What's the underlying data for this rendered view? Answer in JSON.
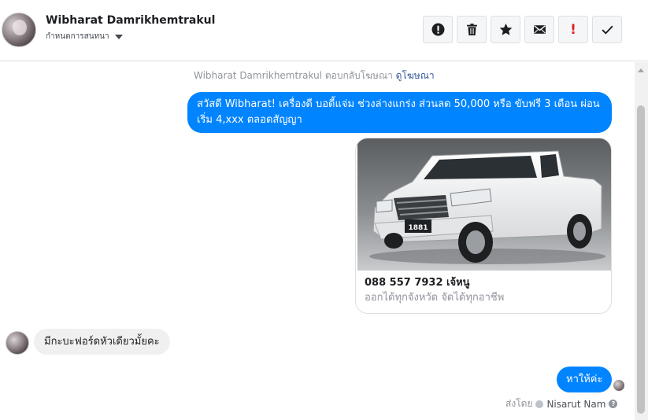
{
  "header": {
    "contact_name": "Wibharat Damrikhemtrakul",
    "assign_label": "กำหนดการสนทนา",
    "toolbar": [
      {
        "name": "info-button",
        "icon": "info-circle-icon"
      },
      {
        "name": "delete-button",
        "icon": "trash-icon"
      },
      {
        "name": "star-button",
        "icon": "star-icon"
      },
      {
        "name": "mark-unread-button",
        "icon": "envelope-icon"
      },
      {
        "name": "spam-button",
        "icon": "exclamation-icon",
        "glyph": "!"
      },
      {
        "name": "done-button",
        "icon": "check-icon"
      }
    ]
  },
  "thread": {
    "ad_reply_text": "Wibharat Damrikhemtrakul ตอบกลับโฆษณา",
    "ad_reply_link": "ดูโฆษณา",
    "outgoing_ad_message": "สวัสดี Wibharat! เครื่องดี บอดี้แจ่ม ช่วงล่างแกร่ง ส่วนลด 50,000 หรือ ขับฟรี 3 เดือน ผ่อนเริ่ม 4,xxx ตลอดสัญญา",
    "ad_card": {
      "plate_text": "1881",
      "phone_title": "088 557 7932 เจ้หนู",
      "description": "ออกได้ทุกจังหวัด จัดได้ทุกอาชีพ"
    },
    "incoming_message": "มีกะบะฟอร์ดหัวเดียวมั้ยคะ",
    "reply_message": "หาให้ค่ะ",
    "sent_by_label": "ส่งโดย",
    "sender_name": "Nisarut Nam"
  },
  "colors": {
    "messenger_blue": "#0084ff",
    "incoming_bubble": "#f1f0f0",
    "border": "#dddfe2",
    "link": "#365899",
    "spam_red": "#e02020"
  }
}
